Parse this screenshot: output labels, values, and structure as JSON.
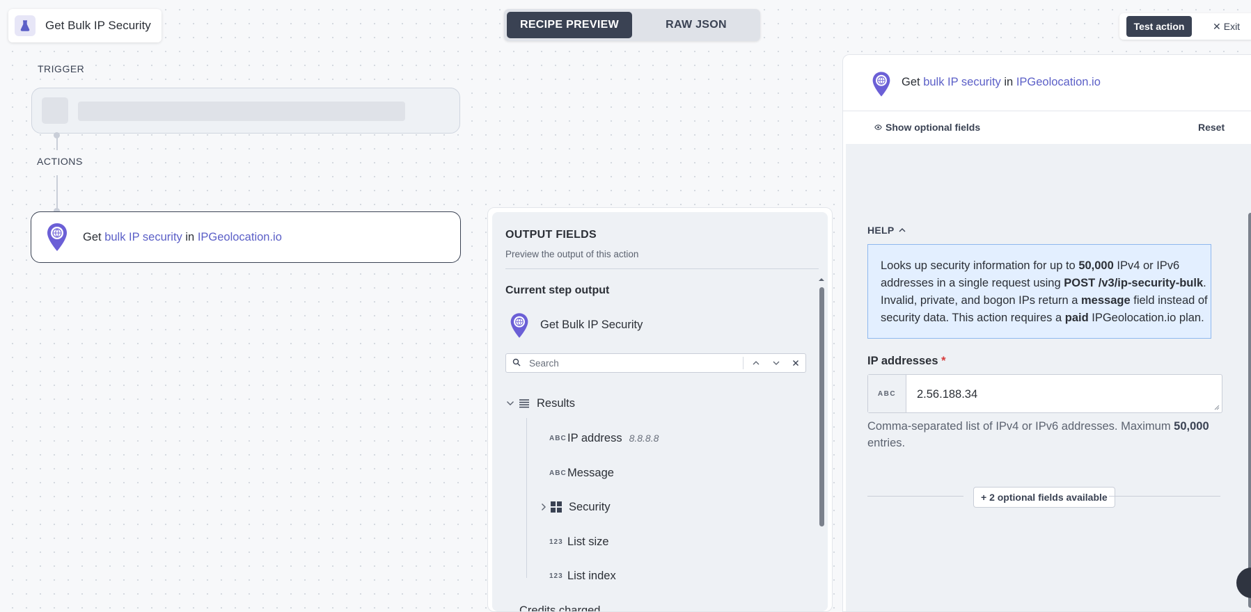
{
  "header": {
    "recipe_title": "Get Bulk IP Security",
    "title_icon": "flask-icon",
    "tabs": [
      {
        "label": "RECIPE PREVIEW",
        "active": true
      },
      {
        "label": "RAW JSON",
        "active": false
      }
    ],
    "test_action_label": "Test action",
    "exit_label": "Exit"
  },
  "flow": {
    "trigger_label": "TRIGGER",
    "actions_label": "ACTIONS",
    "action": {
      "prefix": "Get",
      "object": "bulk IP security",
      "middle": "in",
      "app": "IPGeolocation.io"
    }
  },
  "output_fields": {
    "title": "OUTPUT FIELDS",
    "subtitle": "Preview the output of this action",
    "current_step_label": "Current step output",
    "step_name": "Get Bulk IP Security",
    "search_placeholder": "Search",
    "tree": [
      {
        "type": "list",
        "label": "Results",
        "expanded": true
      },
      {
        "type": "ABC",
        "label": "IP address",
        "sample": "8.8.8.8"
      },
      {
        "type": "ABC",
        "label": "Message"
      },
      {
        "type": "object",
        "label": "Security",
        "expanded": false
      },
      {
        "type": "123",
        "label": "List size"
      },
      {
        "type": "123",
        "label": "List index"
      }
    ],
    "partial_row": "Credits charged"
  },
  "config_panel": {
    "title_prefix": "Get",
    "title_object": "bulk IP security",
    "title_middle": "in",
    "title_app": "IPGeolocation.io",
    "show_optional_label": "Show optional fields",
    "reset_label": "Reset",
    "help_label": "HELP",
    "help_parts": {
      "p1": "Looks up security information for up to ",
      "b1": "50,000",
      "p2": " IPv4 or IPv6 addresses in a single request using ",
      "b2": "POST /v3/ip-security-bulk",
      "p3": ". Invalid, private, and bogon IPs return a ",
      "b3": "message",
      "p4": " field instead of security data. This action requires a ",
      "b4": "paid",
      "p5": " IPGeolocation.io plan."
    },
    "ip_field": {
      "label": "IP addresses",
      "required_marker": "*",
      "type_tag": "ABC",
      "value": "2.56.188.34",
      "hint_pre": "Comma-separated list of IPv4 or IPv6 addresses. Maximum ",
      "hint_bold": "50,000",
      "hint_post": " entries."
    },
    "optional_fields_label": "+ 2 optional fields available"
  },
  "colors": {
    "accent": "#5b5fc7",
    "dark": "#3a4253",
    "help_bg": "#e3efff"
  }
}
